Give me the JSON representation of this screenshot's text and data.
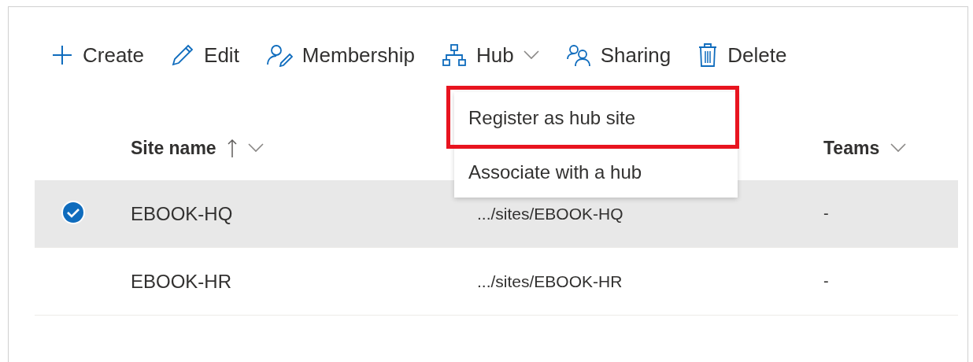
{
  "toolbar": [
    {
      "kind": "create",
      "label": "Create"
    },
    {
      "kind": "edit",
      "label": "Edit"
    },
    {
      "kind": "membership",
      "label": "Membership"
    },
    {
      "kind": "hub",
      "label": "Hub"
    },
    {
      "kind": "sharing",
      "label": "Sharing"
    },
    {
      "kind": "delete",
      "label": "Delete"
    }
  ],
  "hub_menu": [
    {
      "label": "Register as hub site",
      "highlighted": true
    },
    {
      "label": "Associate with a hub",
      "highlighted": false
    }
  ],
  "table": {
    "columns": [
      {
        "label": "Site name",
        "sorted": true
      },
      {
        "label": "Teams",
        "sorted": false
      }
    ],
    "rows": [
      {
        "selected": true,
        "name": "EBOOK-HQ",
        "url": ".../sites/EBOOK-HQ",
        "teams": "-"
      },
      {
        "selected": false,
        "name": "EBOOK-HR",
        "url": ".../sites/EBOOK-HR",
        "teams": "-"
      }
    ]
  }
}
